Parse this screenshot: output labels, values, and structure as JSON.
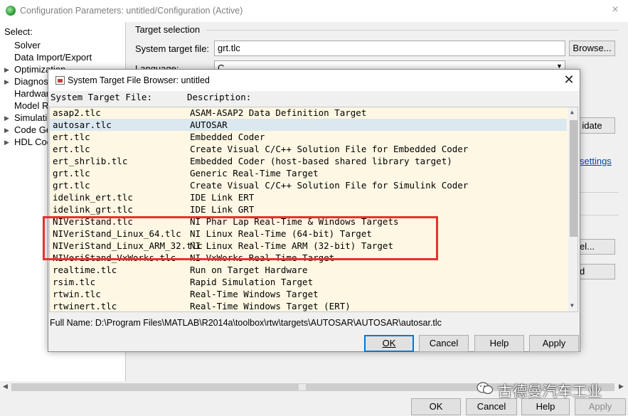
{
  "main_window": {
    "title": "Configuration Parameters: untitled/Configuration (Active)",
    "close_glyph": "×"
  },
  "tree": {
    "header": "Select:",
    "items": [
      {
        "label": "Solver",
        "expandable": false
      },
      {
        "label": "Data Import/Export",
        "expandable": false
      },
      {
        "label": "Optimization",
        "expandable": true
      },
      {
        "label": "Diagnos",
        "expandable": true
      },
      {
        "label": "Hardwar",
        "expandable": false
      },
      {
        "label": "Model R",
        "expandable": false
      },
      {
        "label": "Simulati",
        "expandable": true
      },
      {
        "label": "Code Ge",
        "expandable": true
      },
      {
        "label": "HDL Coc",
        "expandable": true
      }
    ]
  },
  "target_selection": {
    "group_title": "Target selection",
    "system_target_file_label": "System target file:",
    "system_target_file_value": "grt.tlc",
    "browse_label": "Browse...",
    "language_label": "Language:",
    "language_value": "C",
    "validate_label": "idate",
    "settings_link": "settings",
    "partial_button1": "el...",
    "partial_button2": "d"
  },
  "main_buttons": {
    "ok": "OK",
    "cancel": "Cancel",
    "help": "Help",
    "apply": "Apply"
  },
  "dialog": {
    "title": "System Target File Browser: untitled",
    "close_glyph": "✕",
    "header_file": "System Target File:",
    "header_description": "Description:",
    "rows": [
      {
        "file": "asap2.tlc",
        "description": "ASAM-ASAP2 Data Definition Target"
      },
      {
        "file": "autosar.tlc",
        "description": "AUTOSAR"
      },
      {
        "file": "ert.tlc",
        "description": "Embedded Coder"
      },
      {
        "file": "ert.tlc",
        "description": "Create Visual C/C++ Solution File for Embedded Coder"
      },
      {
        "file": "ert_shrlib.tlc",
        "description": "Embedded Coder (host-based shared library target)"
      },
      {
        "file": "grt.tlc",
        "description": "Generic Real-Time Target"
      },
      {
        "file": "grt.tlc",
        "description": "Create Visual C/C++ Solution File for Simulink Coder"
      },
      {
        "file": "idelink_ert.tlc",
        "description": "IDE Link ERT"
      },
      {
        "file": "idelink_grt.tlc",
        "description": "IDE Link GRT"
      },
      {
        "file": "NIVeriStand.tlc",
        "description": "NI Phar Lap Real-Time & Windows Targets"
      },
      {
        "file": "NIVeriStand_Linux_64.tlc",
        "description": "NI Linux Real-Time (64-bit) Target"
      },
      {
        "file": "NIVeriStand_Linux_ARM_32.tlc",
        "description": "NI Linux Real-Time ARM (32-bit) Target"
      },
      {
        "file": "NIVeriStand_VxWorks.tlc",
        "description": "NI VxWorks Real-Time Target"
      },
      {
        "file": "realtime.tlc",
        "description": "Run on Target Hardware"
      },
      {
        "file": "rsim.tlc",
        "description": "Rapid Simulation Target"
      },
      {
        "file": "rtwin.tlc",
        "description": "Real-Time Windows Target"
      },
      {
        "file": "rtwinert.tlc",
        "description": "Real-Time Windows Target (ERT)"
      }
    ],
    "selected_index": 1,
    "full_name": "Full Name:  D:\\Program Files\\MATLAB\\R2014a\\toolbox\\rtw\\targets\\AUTOSAR\\AUTOSAR\\autosar.tlc",
    "buttons": {
      "ok": "OK",
      "cancel": "Cancel",
      "help": "Help",
      "apply": "Apply"
    }
  },
  "watermark": {
    "text": "古德曼汽车工业"
  },
  "colors": {
    "list_background": "#fdf7e3",
    "selected_row": "#dbe8f0",
    "highlight_box": "#e83030",
    "link": "#0645ad",
    "focus_border": "#0078d7"
  }
}
